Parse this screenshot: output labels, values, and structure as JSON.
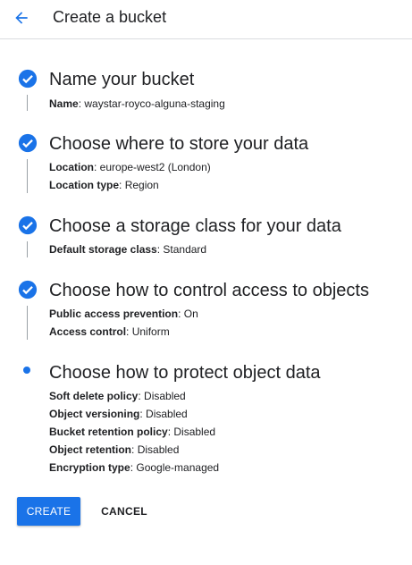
{
  "header": {
    "title": "Create a bucket",
    "back_icon": "arrow-back-icon"
  },
  "steps": [
    {
      "title": "Name your bucket",
      "status": "complete",
      "fields": [
        {
          "label": "Name",
          "value": "waystar-royco-alguna-staging"
        }
      ]
    },
    {
      "title": "Choose where to store your data",
      "status": "complete",
      "fields": [
        {
          "label": "Location",
          "value": "europe-west2 (London)"
        },
        {
          "label": "Location type",
          "value": "Region"
        }
      ]
    },
    {
      "title": "Choose a storage class for your data",
      "status": "complete",
      "fields": [
        {
          "label": "Default storage class",
          "value": "Standard"
        }
      ]
    },
    {
      "title": "Choose how to control access to objects",
      "status": "complete",
      "fields": [
        {
          "label": "Public access prevention",
          "value": "On"
        },
        {
          "label": "Access control",
          "value": "Uniform"
        }
      ]
    },
    {
      "title": "Choose how to protect object data",
      "status": "current",
      "fields": [
        {
          "label": "Soft delete policy",
          "value": "Disabled"
        },
        {
          "label": "Object versioning",
          "value": "Disabled"
        },
        {
          "label": "Bucket retention policy",
          "value": "Disabled"
        },
        {
          "label": "Object retention",
          "value": "Disabled"
        },
        {
          "label": "Encryption type",
          "value": "Google-managed"
        }
      ]
    }
  ],
  "actions": {
    "create_label": "CREATE",
    "cancel_label": "CANCEL"
  },
  "colors": {
    "accent": "#1a73e8",
    "divider": "#dadce0",
    "text": "#202124"
  }
}
